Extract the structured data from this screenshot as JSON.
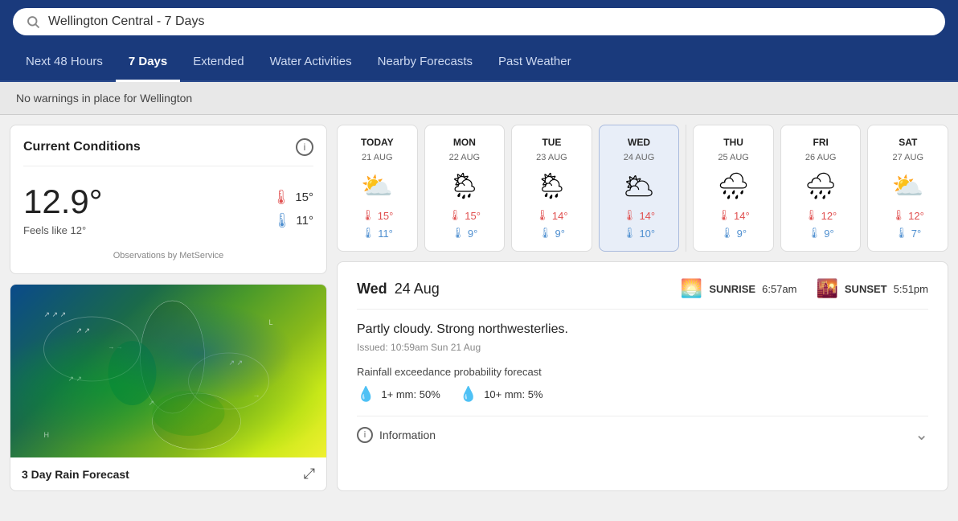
{
  "header": {
    "search_value": "Wellington Central - 7 Days",
    "search_placeholder": "Wellington Central - 7 Days"
  },
  "nav": {
    "tabs": [
      {
        "label": "Next 48 Hours",
        "active": false
      },
      {
        "label": "7 Days",
        "active": true
      },
      {
        "label": "Extended",
        "active": false
      },
      {
        "label": "Water Activities",
        "active": false
      },
      {
        "label": "Nearby Forecasts",
        "active": false
      },
      {
        "label": "Past Weather",
        "active": false
      }
    ]
  },
  "warning": {
    "text": "No warnings in place for Wellington"
  },
  "current_conditions": {
    "title": "Current Conditions",
    "temperature": "12.9°",
    "feels_like": "Feels like 12°",
    "high": "15°",
    "low": "11°",
    "observations_by": "Observations by MetService"
  },
  "rain_forecast": {
    "title": "3 Day Rain Forecast"
  },
  "forecasts": [
    {
      "day": "TODAY",
      "date": "21 AUG",
      "icon": "partly-cloudy",
      "icon_emoji": "⛅",
      "high": "15°",
      "low": "11°",
      "selected": false
    },
    {
      "day": "MON",
      "date": "22 AUG",
      "icon": "cloudy-rain",
      "icon_emoji": "🌦",
      "high": "15°",
      "low": "9°",
      "selected": false
    },
    {
      "day": "TUE",
      "date": "23 AUG",
      "icon": "cloudy-rain",
      "icon_emoji": "🌦",
      "high": "14°",
      "low": "9°",
      "selected": false
    },
    {
      "day": "WED",
      "date": "24 AUG",
      "icon": "mostly-cloudy",
      "icon_emoji": "🌥",
      "high": "14°",
      "low": "10°",
      "selected": true
    },
    {
      "day": "THU",
      "date": "25 AUG",
      "icon": "heavy-rain",
      "icon_emoji": "🌧",
      "high": "14°",
      "low": "9°",
      "selected": false
    },
    {
      "day": "FRI",
      "date": "26 AUG",
      "icon": "heavy-rain",
      "icon_emoji": "🌧",
      "high": "12°",
      "low": "9°",
      "selected": false
    },
    {
      "day": "SAT",
      "date": "27 AUG",
      "icon": "partly-cloudy",
      "icon_emoji": "⛅",
      "high": "12°",
      "low": "7°",
      "selected": false
    }
  ],
  "detail": {
    "date_label": "Wed",
    "date_full": "24 Aug",
    "sunrise_label": "SUNRISE",
    "sunrise_time": "6:57am",
    "sunset_label": "SUNSET",
    "sunset_time": "5:51pm",
    "description": "Partly cloudy. Strong northwesterlies.",
    "issued": "Issued: 10:59am Sun 21 Aug",
    "rainfall_label": "Rainfall exceedance probability forecast",
    "prob_1mm": "1+ mm: 50%",
    "prob_10mm": "10+ mm: 5%",
    "information_label": "Information"
  }
}
